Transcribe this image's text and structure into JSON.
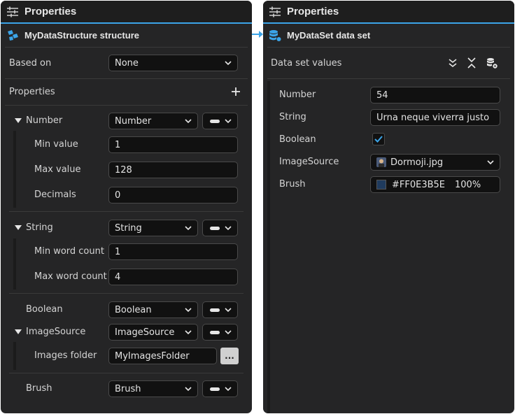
{
  "left_panel": {
    "title": "Properties",
    "structure_title": "MyDataStructure structure",
    "based_on_label": "Based on",
    "based_on_value": "None",
    "properties_label": "Properties",
    "number": {
      "label": "Number",
      "type": "Number",
      "min_label": "Min value",
      "min_value": "1",
      "max_label": "Max value",
      "max_value": "128",
      "decimals_label": "Decimals",
      "decimals_value": "0"
    },
    "string": {
      "label": "String",
      "type": "String",
      "min_label": "Min word count",
      "min_value": "1",
      "max_label": "Max word count",
      "max_value": "4"
    },
    "boolean": {
      "label": "Boolean",
      "type": "Boolean"
    },
    "imagesource": {
      "label": "ImageSource",
      "type": "ImageSource",
      "folder_label": "Images folder",
      "folder_value": "MyImagesFolder",
      "browse_label": "..."
    },
    "brush": {
      "label": "Brush",
      "type": "Brush"
    }
  },
  "right_panel": {
    "title": "Properties",
    "dataset_title": "MyDataSet data set",
    "values_label": "Data set values",
    "number_label": "Number",
    "number_value": "54",
    "string_label": "String",
    "string_value": "Urna neque viverra justo",
    "boolean_label": "Boolean",
    "boolean_checked": true,
    "imagesource_label": "ImageSource",
    "imagesource_value": "Dormoji.jpg",
    "brush_label": "Brush",
    "brush_hex": "#FF0E3B5E",
    "brush_opacity": "100%"
  },
  "colors": {
    "accent": "#3ba4e8",
    "panel_bg": "#252526",
    "field_bg": "#111111",
    "brush_swatch": "#0E3B5E"
  }
}
